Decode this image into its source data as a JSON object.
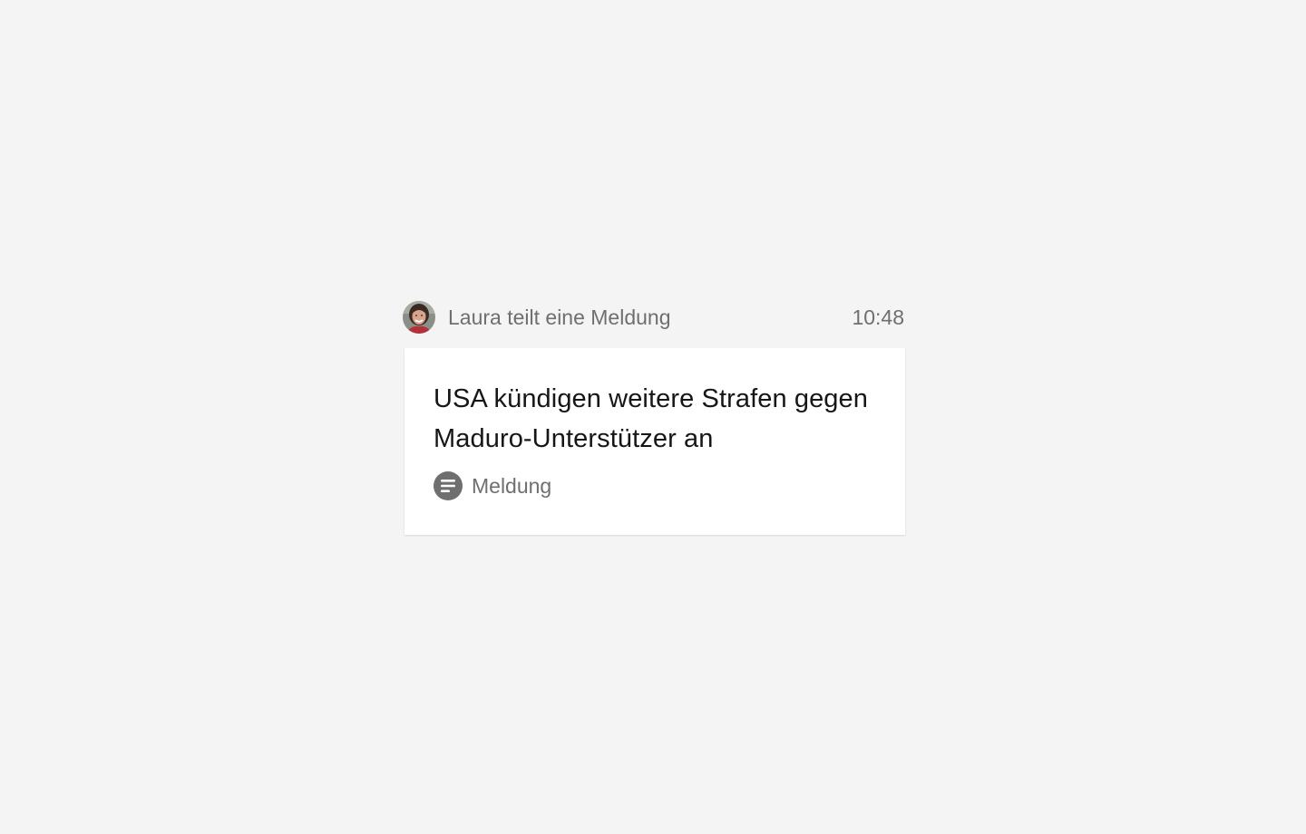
{
  "feed_entry": {
    "header": {
      "avatar_icon": "user-avatar-photo",
      "share_text": "Laura teilt eine Meldung",
      "time": "10:48"
    },
    "card": {
      "headline": "USA kündigen weitere Strafen gegen Maduro-Unterstützer an",
      "type_icon": "document-lines-icon",
      "type_label": "Meldung"
    }
  }
}
